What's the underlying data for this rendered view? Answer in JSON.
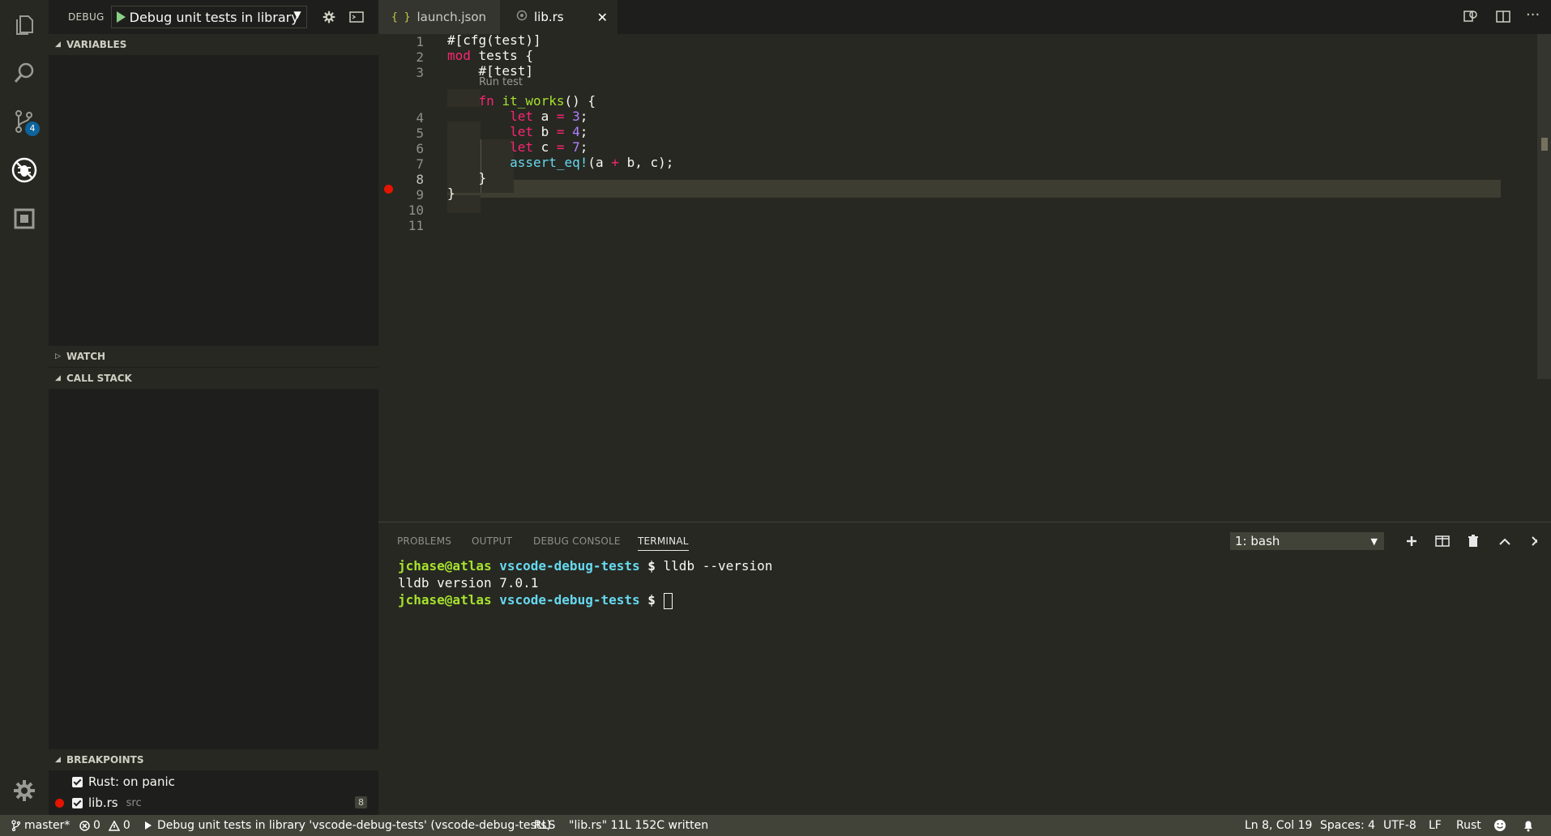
{
  "activity_bar": {
    "items": [
      "explorer",
      "search",
      "source-control",
      "debug",
      "extensions"
    ],
    "scm_badge": "4"
  },
  "sidebar": {
    "debug_label": "DEBUG",
    "config_name": "Debug unit tests in library",
    "sections": {
      "variables": "VARIABLES",
      "watch": "WATCH",
      "call_stack": "CALL STACK",
      "breakpoints": "BREAKPOINTS"
    },
    "breakpoints": [
      {
        "label": "Rust: on panic",
        "checked": true
      },
      {
        "label": "lib.rs",
        "source": "src",
        "line": "8",
        "checked": true
      }
    ]
  },
  "tabs": [
    {
      "label": "launch.json",
      "icon": "{ }",
      "active": false
    },
    {
      "label": "lib.rs",
      "icon": "rust-icon",
      "active": true
    }
  ],
  "editor": {
    "line_numbers": [
      "1",
      "2",
      "3",
      "4",
      "5",
      "6",
      "7",
      "8",
      "9",
      "10",
      "11"
    ],
    "codelens": "Run test",
    "current_line": 8,
    "breakpoint_line": 8
  },
  "panel": {
    "tabs": [
      "PROBLEMS",
      "OUTPUT",
      "DEBUG CONSOLE",
      "TERMINAL"
    ],
    "active_tab": "TERMINAL",
    "terminal_select": "1: bash",
    "terminal": {
      "prompt_user": "jchase@atlas",
      "prompt_path": "vscode-debug-tests",
      "prompt_symbol": "$",
      "command1": " lldb --version",
      "output1": "lldb version 7.0.1"
    }
  },
  "status": {
    "branch": "master*",
    "errors": "0",
    "warnings": "0",
    "debug_text": "Debug unit tests in library 'vscode-debug-tests' (vscode-debug-tests)",
    "rls": "RLS",
    "written": "\"lib.rs\" 11L 152C written",
    "position": "Ln 8, Col 19",
    "spaces": "Spaces: 4",
    "encoding": "UTF-8",
    "eol": "LF",
    "language": "Rust"
  },
  "colors": {
    "background": "#272822",
    "sidebar": "#1e1f1c",
    "status_bar": "#414339",
    "keyword": "#f92672",
    "function": "#a6e22e",
    "number": "#ae81ff",
    "macro": "#66d9ef",
    "breakpoint": "#e51400"
  }
}
